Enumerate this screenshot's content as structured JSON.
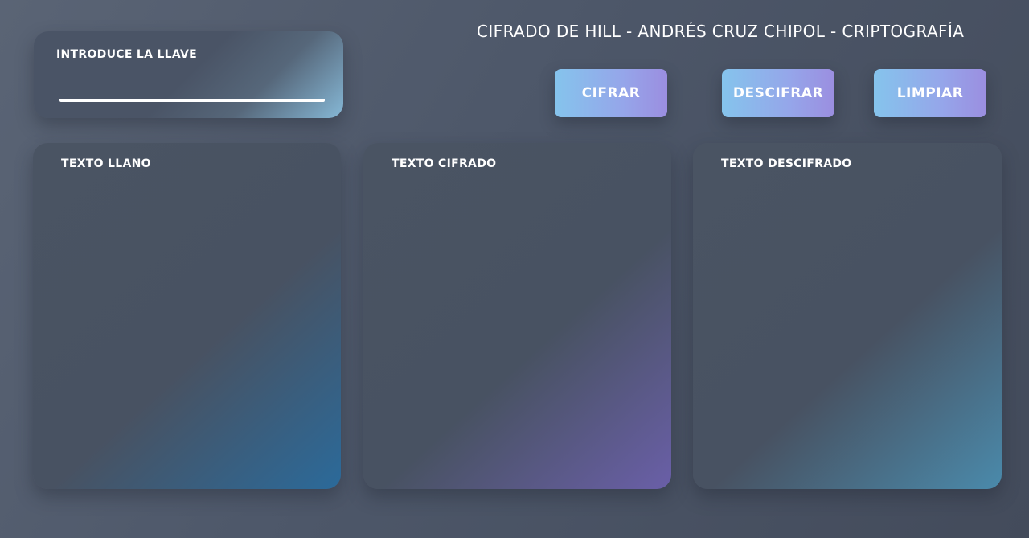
{
  "header": {
    "title": "CIFRADO DE HILL - ANDRÉS CRUZ CHIPOL - CRIPTOGRAFÍA"
  },
  "key": {
    "label": "INTRODUCE LA LLAVE",
    "value": "",
    "placeholder": ""
  },
  "buttons": {
    "encrypt": "CIFRAR",
    "decrypt": "DESCIFRAR",
    "clear": "LIMPIAR"
  },
  "panels": [
    {
      "label": "TEXTO LLANO",
      "value": ""
    },
    {
      "label": "TEXTO CIFRADO",
      "value": ""
    },
    {
      "label": "TEXTO DESCIFRADO",
      "value": ""
    }
  ],
  "colors": {
    "background": "#4d5769",
    "button_gradient_start": "#85c4ec",
    "button_gradient_end": "#9b8ee0",
    "panel_llano_accent": "#2b6a9a",
    "panel_cifrado_accent": "#6a5fa8",
    "panel_descifrado_accent": "#4a8aab",
    "text": "#ffffff"
  }
}
